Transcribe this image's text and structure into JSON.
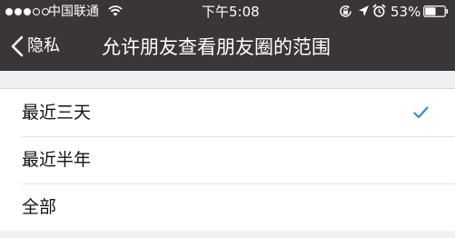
{
  "status_bar": {
    "carrier": "中国联通",
    "time": "下午5:08",
    "battery_percent": "53%",
    "signal_strength": 3,
    "signal_total": 5,
    "icons": [
      "wifi-icon",
      "rotation-lock-icon",
      "location-arrow-icon",
      "alarm-clock-icon",
      "battery-icon"
    ]
  },
  "nav": {
    "back_label": "隐私",
    "title": "允许朋友查看朋友圈的范围"
  },
  "options": [
    {
      "label": "最近三天",
      "selected": true
    },
    {
      "label": "最近半年",
      "selected": false
    },
    {
      "label": "全部",
      "selected": false
    }
  ],
  "colors": {
    "nav_background": "#3a3539",
    "page_background": "#efeff4",
    "accent": "#2f8bd8"
  }
}
